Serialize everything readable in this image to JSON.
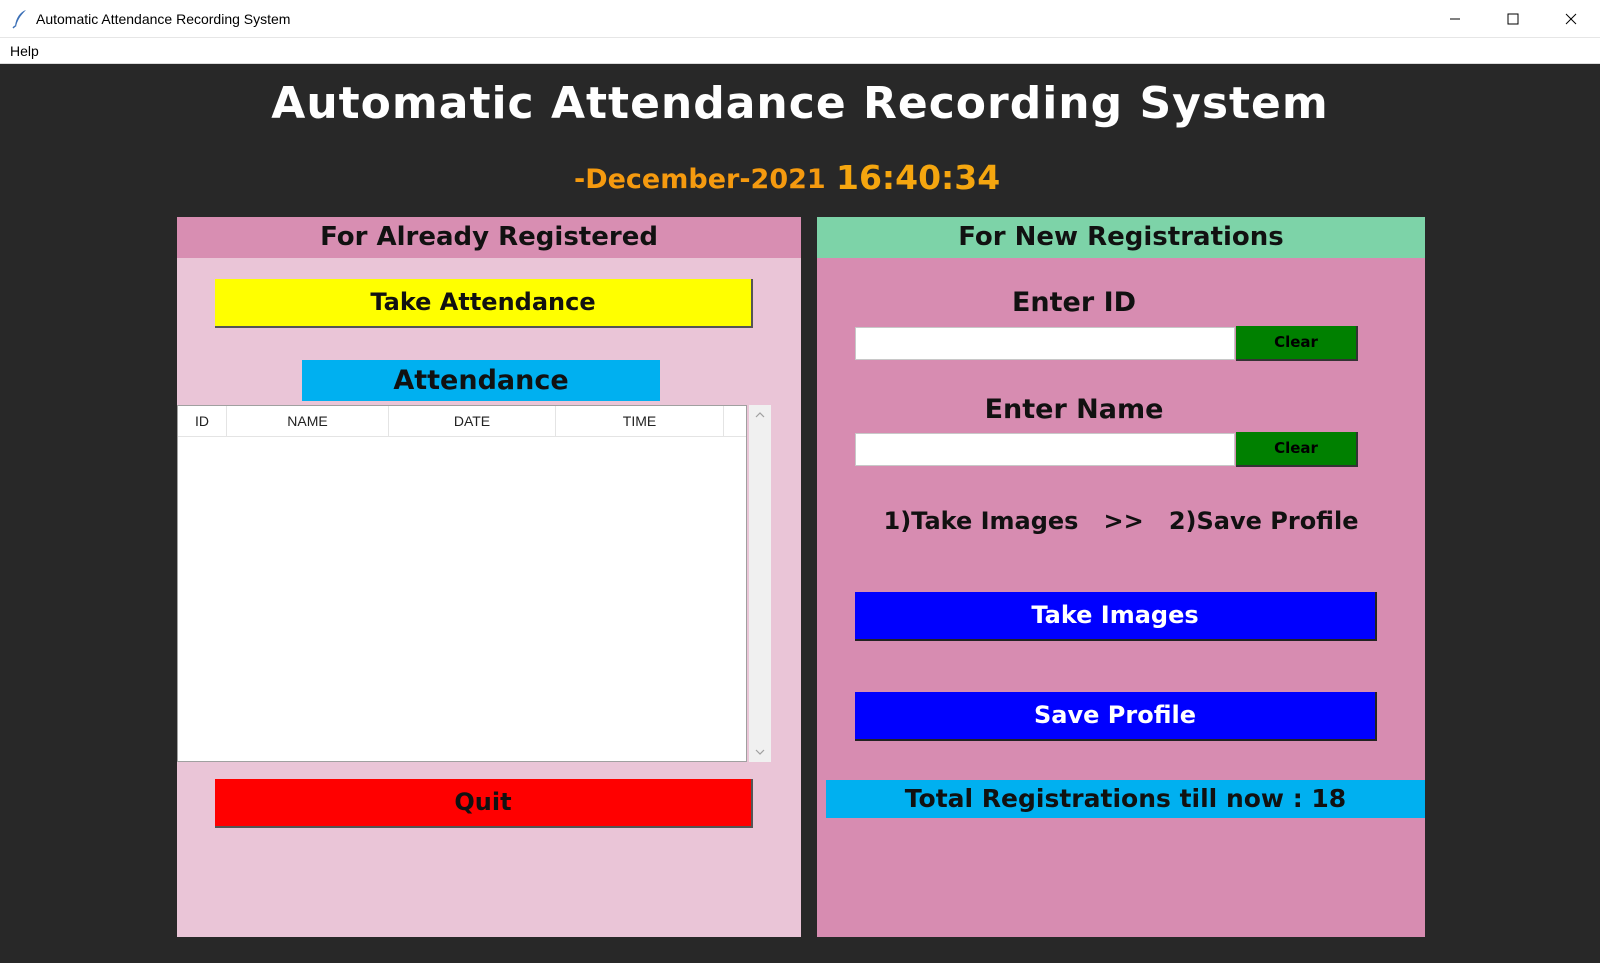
{
  "window": {
    "title": "Automatic Attendance Recording System",
    "controls": {
      "minimize": "minimize",
      "maximize": "maximize",
      "close": "close"
    }
  },
  "menu": {
    "help": "Help"
  },
  "header": {
    "title": "Automatic Attendance Recording System",
    "date": "-December-2021",
    "time": "16:40:34"
  },
  "left_panel": {
    "title": "For Already Registered",
    "take_attendance_label": "Take Attendance",
    "attendance_label": "Attendance",
    "table": {
      "columns": [
        "ID",
        "NAME",
        "DATE",
        "TIME"
      ],
      "rows": []
    },
    "quit_label": "Quit"
  },
  "right_panel": {
    "title": "For New Registrations",
    "id_label": "Enter ID",
    "id_value": "",
    "name_label": "Enter Name",
    "name_value": "",
    "clear_label": "Clear",
    "steps": {
      "step1": "1)Take Images",
      "separator": ">>",
      "step2": "2)Save Profile"
    },
    "take_images_label": "Take Images",
    "save_profile_label": "Save Profile",
    "total_registrations_text": "Total Registrations till now  : 18"
  },
  "colors": {
    "background": "#282828",
    "left_panel_bg": "#eac5d7",
    "left_header_bg": "#d88eb2",
    "right_panel_bg": "#d78cb1",
    "right_header_bg": "#7dd3a8",
    "take_attendance_btn": "#ffff00",
    "attendance_label_bg": "#00b0f0",
    "quit_btn": "#ff0000",
    "clear_btn": "#008000",
    "action_btn": "#0000ff",
    "date_color": "#f59a0f"
  }
}
